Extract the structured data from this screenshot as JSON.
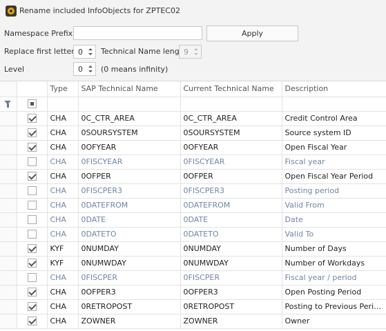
{
  "window": {
    "title": "Rename included InfoObjects for ZPTEC02",
    "icon": "app-icon"
  },
  "form": {
    "namespace_label": "Namespace Prefix",
    "namespace_value": "",
    "apply_label": "Apply",
    "replace_label": "Replace first letters",
    "replace_value": "0",
    "tech_length_label": "Technical Name length",
    "tech_length_value": "9",
    "level_label": "Level",
    "level_value": "0",
    "level_hint": "(0 means infinity)"
  },
  "grid": {
    "columns": [
      "Type",
      "SAP Technical Name",
      "Current Technical Name",
      "Description"
    ],
    "rows": [
      {
        "checked": true,
        "type": "CHA",
        "sap": "0C_CTR_AREA",
        "current": "0C_CTR_AREA",
        "desc": "Credit Control Area"
      },
      {
        "checked": true,
        "type": "CHA",
        "sap": "0SOURSYSTEM",
        "current": "0SOURSYSTEM",
        "desc": "Source system ID"
      },
      {
        "checked": true,
        "type": "CHA",
        "sap": "0OFYEAR",
        "current": "0OFYEAR",
        "desc": "Open Fiscal Year"
      },
      {
        "checked": false,
        "type": "CHA",
        "sap": "0FISCYEAR",
        "current": "0FISCYEAR",
        "desc": "Fiscal year"
      },
      {
        "checked": true,
        "type": "CHA",
        "sap": "0OFPER",
        "current": "0OFPER",
        "desc": "Open Fiscal Year Period"
      },
      {
        "checked": false,
        "type": "CHA",
        "sap": "0FISCPER3",
        "current": "0FISCPER3",
        "desc": "Posting period"
      },
      {
        "checked": false,
        "type": "CHA",
        "sap": "0DATEFROM",
        "current": "0DATEFROM",
        "desc": "Valid From"
      },
      {
        "checked": false,
        "type": "CHA",
        "sap": "0DATE",
        "current": "0DATE",
        "desc": "Date"
      },
      {
        "checked": false,
        "type": "CHA",
        "sap": "0DATETO",
        "current": "0DATETO",
        "desc": "Valid To"
      },
      {
        "checked": true,
        "type": "KYF",
        "sap": "0NUMDAY",
        "current": "0NUMDAY",
        "desc": "Number of Days"
      },
      {
        "checked": true,
        "type": "KYF",
        "sap": "0NUMWDAY",
        "current": "0NUMWDAY",
        "desc": "Number of Workdays"
      },
      {
        "checked": false,
        "type": "CHA",
        "sap": "0FISCPER",
        "current": "0FISCPER",
        "desc": "Fiscal year / period"
      },
      {
        "checked": true,
        "type": "CHA",
        "sap": "0OFPER3",
        "current": "0OFPER3",
        "desc": "Open Posting Period"
      },
      {
        "checked": true,
        "type": "CHA",
        "sap": "0RETROPOST",
        "current": "0RETROPOST",
        "desc": "Posting to Previous Period ..."
      },
      {
        "checked": true,
        "type": "CHA",
        "sap": "ZOWNER",
        "current": "ZOWNER",
        "desc": "Owner"
      }
    ]
  },
  "colors": {
    "inactive_text": "#6f86a6",
    "accent": "#e8a317"
  }
}
